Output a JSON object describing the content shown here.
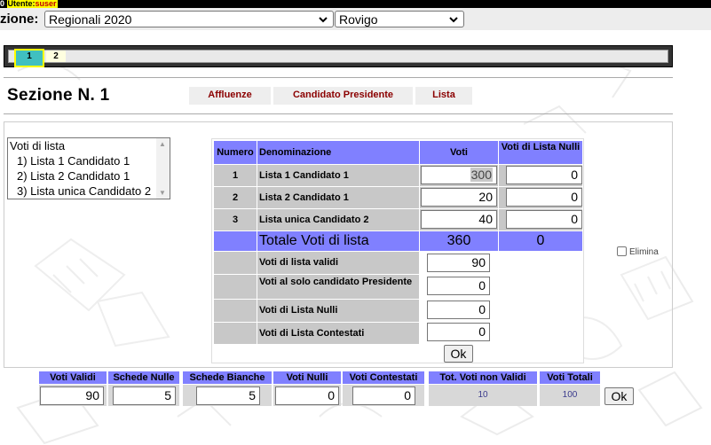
{
  "topbar": {
    "prefix": "0 ",
    "user_label": "Utente:",
    "user_value": "suser"
  },
  "header": {
    "consultazione_label": "zione:",
    "election_select": "Regionali 2020",
    "province_select": "Rovigo"
  },
  "section_tabs": [
    "1",
    "2"
  ],
  "sezione_title": "Sezione N. 1",
  "top_tabs": [
    "Affluenze",
    "Candidato Presidente",
    "Lista"
  ],
  "listbox": {
    "items": [
      "Voti di lista",
      "1) Lista 1 Candidato 1",
      "2) Lista 2 Candidato 1",
      "3) Lista unica Candidato 2"
    ],
    "scroll_up": "▲",
    "scroll_down": "▼"
  },
  "table": {
    "headers": {
      "numero": "Numero",
      "denominazione": "Denominazione",
      "voti": "Voti",
      "voti_nulli": "Voti di Lista Nulli"
    },
    "rows": [
      {
        "numero": "1",
        "denominazione": "Lista 1 Candidato 1",
        "voti": "300",
        "nulli": "0"
      },
      {
        "numero": "2",
        "denominazione": "Lista 2 Candidato 1",
        "voti": "20",
        "nulli": "0"
      },
      {
        "numero": "3",
        "denominazione": "Lista unica Candidato 2",
        "voti": "40",
        "nulli": "0"
      }
    ],
    "totale_label": "Totale Voti di lista",
    "totale_voti": "360",
    "totale_nulli": "0",
    "extra_rows": [
      {
        "label": "Voti di lista validi",
        "value": "90"
      },
      {
        "label": "Voti al solo candidato Presidente",
        "value": "0"
      },
      {
        "label": "Voti di Lista Nulli",
        "value": "0"
      },
      {
        "label": "Voti di Lista Contestati",
        "value": "0"
      }
    ],
    "ok_label": "Ok"
  },
  "elimina_label": "Elimina",
  "bottom": {
    "headers": [
      "Voti Validi",
      "Schede Nulle",
      "Schede Bianche",
      "Voti Nulli",
      "Voti Contestati",
      "Tot. Voti non Validi",
      "Voti Totali"
    ],
    "inputs": [
      "90",
      "5",
      "5",
      "0",
      "0"
    ],
    "tot_non_validi": "10",
    "voti_totali": "100",
    "ok_label": "Ok"
  },
  "colors": {
    "header_blue": "#8080ff",
    "cell_grey": "#c8c8c8",
    "tab_text": "#8b0000",
    "tab_active": "#40c0c0",
    "tab_highlight": "#ffff00"
  }
}
